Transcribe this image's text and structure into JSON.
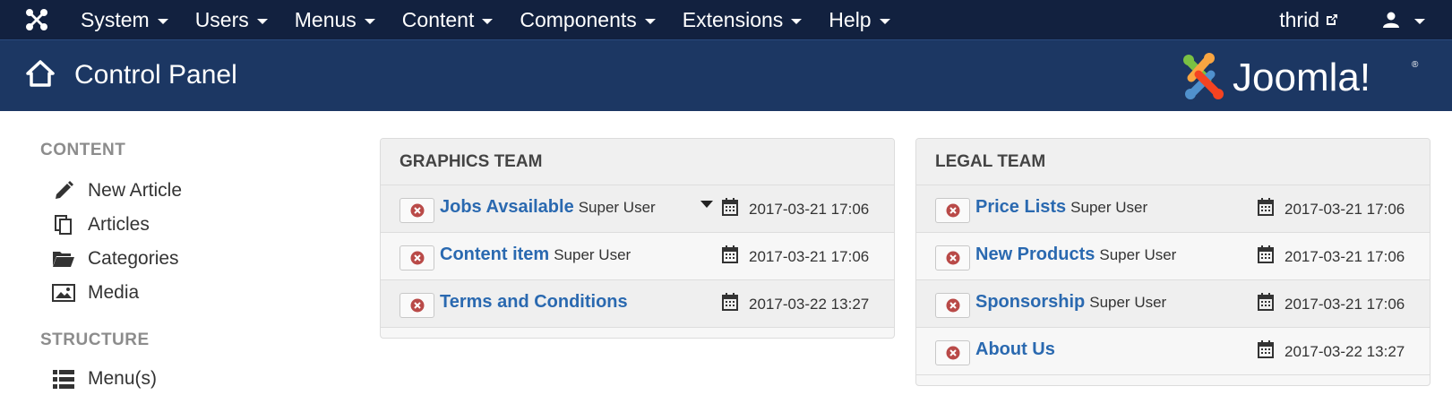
{
  "nav": {
    "menus": [
      {
        "label": "System"
      },
      {
        "label": "Users"
      },
      {
        "label": "Menus"
      },
      {
        "label": "Content"
      },
      {
        "label": "Components"
      },
      {
        "label": "Extensions"
      },
      {
        "label": "Help"
      }
    ],
    "site_link": "thrid"
  },
  "header": {
    "title": "Control Panel",
    "logo_text": "Joomla!"
  },
  "sidebar": {
    "content_title": "CONTENT",
    "content_items": [
      {
        "label": "New Article",
        "icon": "pencil-icon"
      },
      {
        "label": "Articles",
        "icon": "copy-icon"
      },
      {
        "label": "Categories",
        "icon": "folder-icon"
      },
      {
        "label": "Media",
        "icon": "image-icon"
      }
    ],
    "structure_title": "STRUCTURE",
    "structure_items": [
      {
        "label": "Menu(s)",
        "icon": "list-icon"
      }
    ]
  },
  "panels": {
    "graphics": {
      "title": "GRAPHICS TEAM",
      "rows": [
        {
          "title": "Jobs Avsailable",
          "author": "Super User",
          "date": "2017-03-21 17:06"
        },
        {
          "title": "Content item",
          "author": "Super User",
          "date": "2017-03-21 17:06"
        },
        {
          "title": "Terms and Conditions",
          "author": "",
          "date": "2017-03-22 13:27"
        }
      ]
    },
    "legal": {
      "title": "LEGAL TEAM",
      "rows": [
        {
          "title": "Price Lists",
          "author": "Super User",
          "date": "2017-03-21 17:06"
        },
        {
          "title": "New Products",
          "author": "Super User",
          "date": "2017-03-21 17:06"
        },
        {
          "title": "Sponsorship",
          "author": "Super User",
          "date": "2017-03-21 17:06"
        },
        {
          "title": "About Us",
          "author": "",
          "date": "2017-03-22 13:27"
        }
      ]
    }
  },
  "colors": {
    "navbar": "#12213f",
    "header": "#1c3763",
    "link": "#2a69b0",
    "checkin_x": "#b94a48"
  }
}
